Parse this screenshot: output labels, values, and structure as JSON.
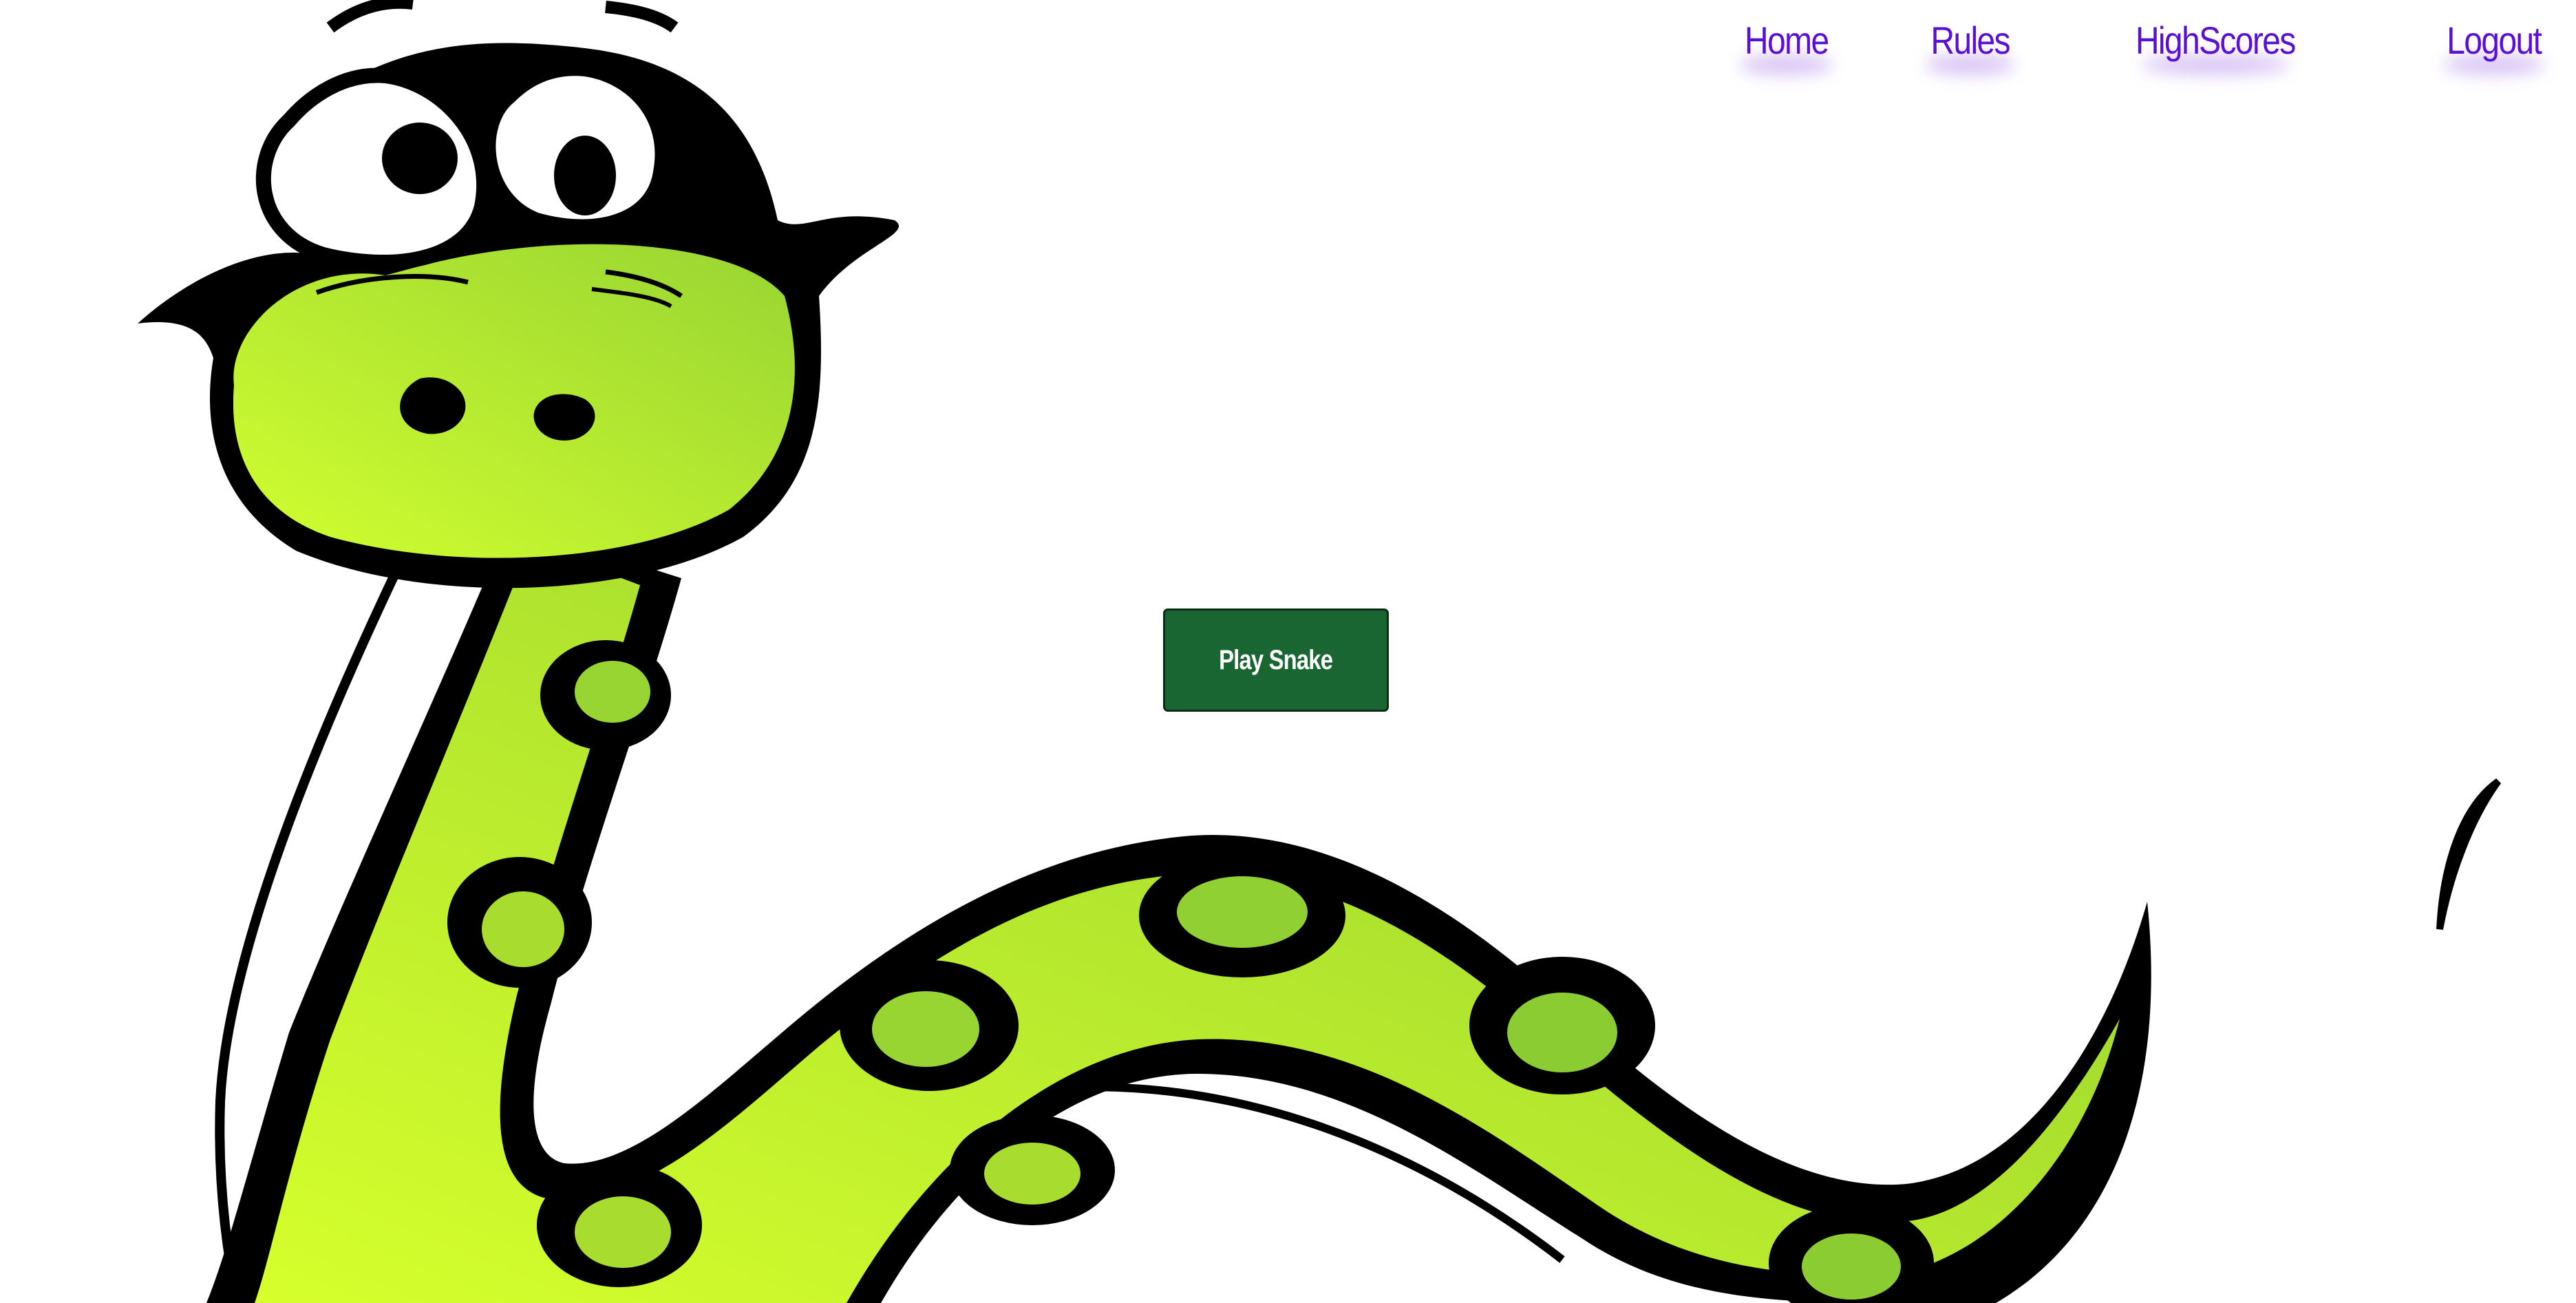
{
  "nav": {
    "items": [
      {
        "label": "Home"
      },
      {
        "label": "Rules"
      },
      {
        "label": "HighScores"
      },
      {
        "label": "Logout"
      }
    ],
    "color": "#5a0fd6"
  },
  "main": {
    "play_button_label": "Play Snake",
    "play_button_color": "#1a6633"
  },
  "illustration": {
    "subject": "cartoon-snake",
    "body_color": "#a6dd2e",
    "spot_color": "#000000"
  }
}
